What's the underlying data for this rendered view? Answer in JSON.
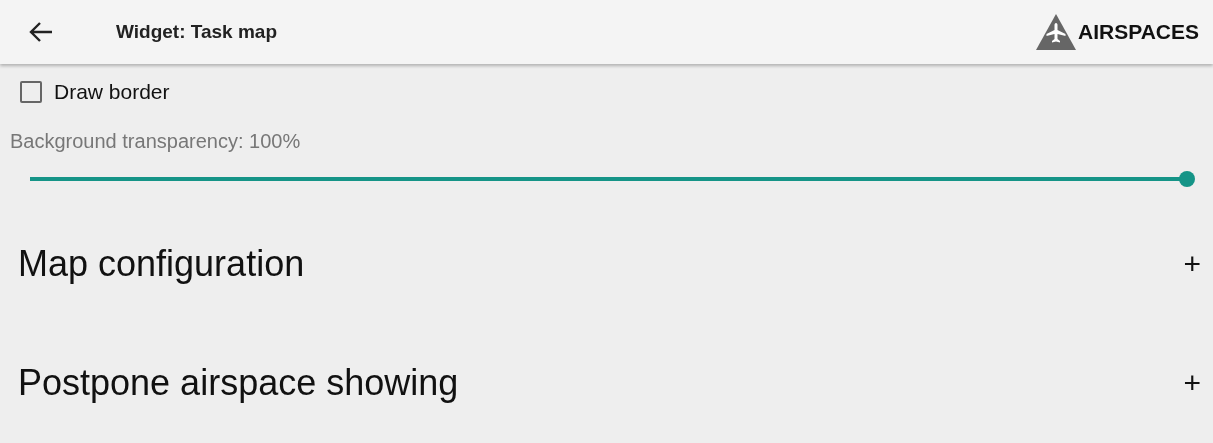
{
  "header": {
    "title": "Widget: Task map",
    "action_label": "AIRSPACES"
  },
  "draw_border": {
    "label": "Draw border",
    "checked": false
  },
  "transparency": {
    "label": "Background transparency: 100%",
    "level": 1
  },
  "sections": [
    {
      "title": "Map configuration",
      "toggle": "+"
    },
    {
      "title": "Postpone airspace showing",
      "toggle": "+"
    }
  ]
}
